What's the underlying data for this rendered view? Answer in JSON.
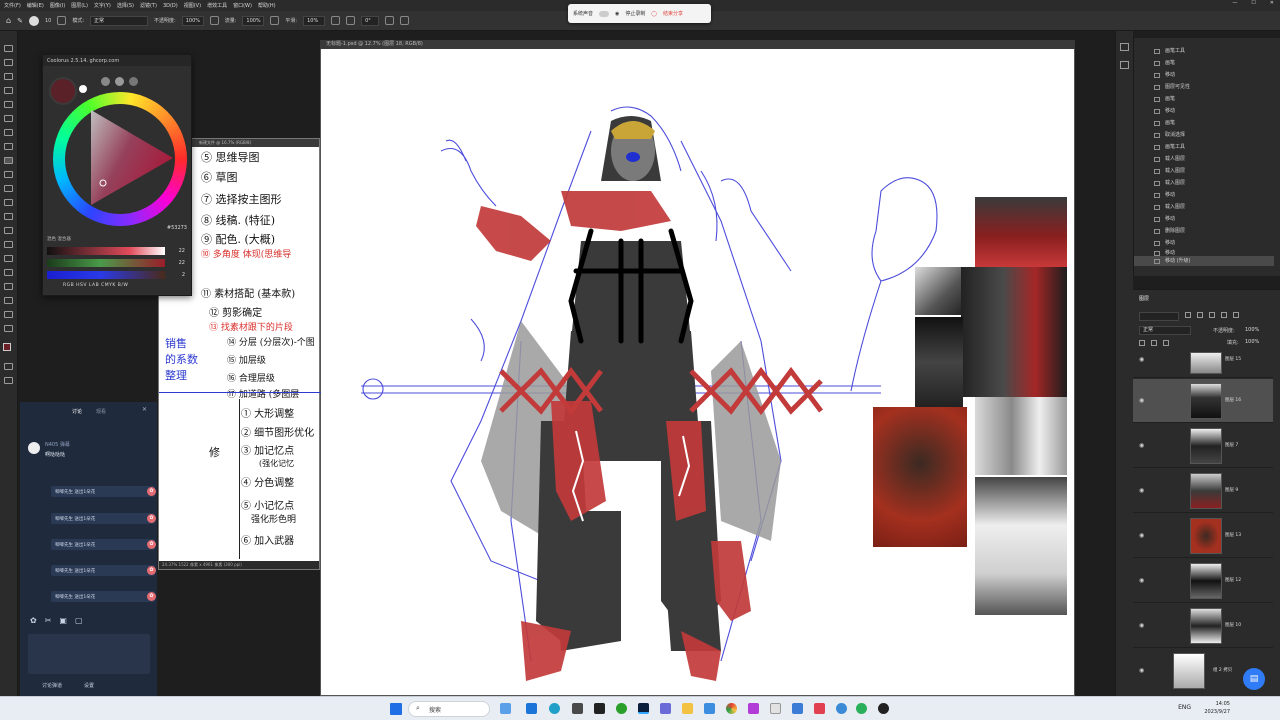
{
  "menubar": {
    "items": [
      "文件(F)",
      "编辑(E)",
      "图像(I)",
      "图层(L)",
      "文字(Y)",
      "选择(S)",
      "滤镜(T)",
      "3D(D)",
      "视图(V)",
      "增效工具",
      "窗口(W)",
      "帮助(H)"
    ]
  },
  "options": {
    "mode_label": "模式:",
    "mode_value": "正常",
    "opacity_label": "不透明度:",
    "opacity_value": "100%",
    "flow_label": "流量:",
    "flow_value": "100%",
    "smooth_label": "平滑:",
    "smooth_value": "10%",
    "angle_value": "0°",
    "brush_size": "10"
  },
  "recording": {
    "sys_audio_label": "系统声音",
    "pause_label": "停止录制",
    "stop_label": "结束分享"
  },
  "document": {
    "title": "无标题-1.psd @ 12.7% (图层 18, RGB/8)"
  },
  "notes": {
    "title": "新建文件 @ 16.7% (RGB/8)",
    "status": "24.37%   1522 像素 x 4961 像素 (300 ppi)",
    "lines": [
      {
        "text": "⑤ 思维导图",
        "cls": ""
      },
      {
        "text": "⑥ 草图",
        "cls": ""
      },
      {
        "text": "⑦ 选择按主图形",
        "cls": ""
      },
      {
        "text": "⑧ 线稿. (特征)",
        "cls": ""
      },
      {
        "text": "⑨ 配色. (大概)",
        "cls": ""
      },
      {
        "text": "⑩ 多角度 体现(思维导",
        "cls": "red"
      },
      {
        "text": "⑪ 素材搭配 (基本款)",
        "cls": ""
      },
      {
        "text": "⑫ 剪影确定",
        "cls": ""
      },
      {
        "text": "⑬ 找素材跟下的片段",
        "cls": "red"
      },
      {
        "text": "⑭ 分层 (分层次)-个图",
        "cls": ""
      },
      {
        "text": "⑮ 加层级",
        "cls": ""
      },
      {
        "text": "⑯ 合理层级",
        "cls": ""
      },
      {
        "text": "⑰ 加道路 (多图层",
        "cls": ""
      },
      {
        "text": "① 大形调整",
        "cls": ""
      },
      {
        "text": "② 细节图形优化",
        "cls": ""
      },
      {
        "text": "③ 加记忆点",
        "cls": ""
      },
      {
        "text": "(强化记忆",
        "cls": ""
      },
      {
        "text": "④ 分色调整",
        "cls": ""
      },
      {
        "text": "⑤ 小记忆点",
        "cls": ""
      },
      {
        "text": "强化形色明",
        "cls": ""
      },
      {
        "text": "⑥ 加入武器",
        "cls": ""
      }
    ],
    "side_labels": [
      "销售",
      "的系数",
      "整理"
    ],
    "mark": "修"
  },
  "picker": {
    "title": "Coolorus 2.5.14. ghcorp.com",
    "hex": "#53273",
    "tabs": "混色  混合器",
    "slider_values": [
      "22",
      "22",
      "2"
    ],
    "modes": "RGB  HSV  LAB  CMYK  B/W"
  },
  "chat": {
    "tabs": [
      "讨论",
      "观看"
    ],
    "user": "N405 弹幕",
    "user_msg": "啊哒哒哒",
    "gift_messages": [
      "唧唧先生 送出1朵花",
      "唧唧先生 送出1朵花",
      "唧唧先生 送出1朵花",
      "唧唧先生 送出1朵花",
      "唧唧先生 送出1朵花"
    ],
    "footer_left": "讨论弹道",
    "footer_right": "设置"
  },
  "history": {
    "items": [
      "画笔工具",
      "画笔",
      "移动",
      "图层可见性",
      "画笔",
      "移动",
      "画笔",
      "取消选择",
      "画笔工具",
      "载人图层",
      "载入图层",
      "载入图层",
      "移动",
      "载入图层",
      "移动",
      "删除图层",
      "移动",
      "移动"
    ],
    "selected": "移动 (升级)"
  },
  "layers": {
    "tab": "图层",
    "blend": "正常",
    "opacity_label": "不透明度:",
    "opacity_value": "100%",
    "fill_label": "填充:",
    "fill_value": "100%",
    "items": [
      "图层 15",
      "图层 16",
      "图层 7",
      "图层 9",
      "图层 13",
      "图层 12",
      "图层 10",
      "组 2 拷贝"
    ]
  },
  "taskbar": {
    "search_placeholder": "搜索",
    "lang": "ENG",
    "time": "14:05",
    "date": "2023/9/27"
  }
}
